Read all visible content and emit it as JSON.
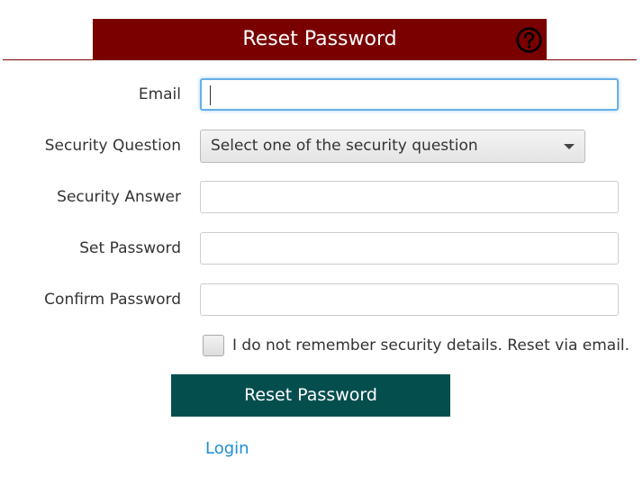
{
  "header": {
    "title": "Reset Password",
    "help_icon": "question-circle-icon"
  },
  "form": {
    "email": {
      "label": "Email",
      "value": ""
    },
    "security_question": {
      "label": "Security Question",
      "selected": "Select one of the security question"
    },
    "security_answer": {
      "label": "Security Answer",
      "value": ""
    },
    "set_password": {
      "label": "Set Password",
      "value": ""
    },
    "confirm_password": {
      "label": "Confirm Password",
      "value": ""
    },
    "reset_via_email": {
      "label": "I do not remember security details. Reset via email.",
      "checked": false
    }
  },
  "actions": {
    "reset_label": "Reset Password",
    "login_label": "Login"
  },
  "colors": {
    "header_bg": "#7a0000",
    "button_bg": "#044e4e",
    "link": "#1c8ed8",
    "focus_border": "#66afe9"
  }
}
